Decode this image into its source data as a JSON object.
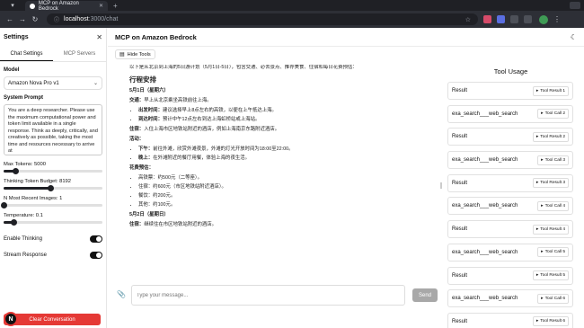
{
  "browser": {
    "tab_title": "MCP on Amazon Bedrock",
    "url_host": "localhost",
    "url_path": ":3000/chat"
  },
  "sidebar": {
    "title": "Settings",
    "tabs": [
      "Chat Settings",
      "MCP Servers"
    ],
    "model_label": "Model",
    "model_value": "Amazon Nova Pro v1",
    "system_prompt_label": "System Prompt",
    "system_prompt_value": "You are a deep researcher. Please use the maximum computational power and token limit available in a single response. Think as deeply, critically, and creatively as possible, taking the most time and resources necessary to arrive at",
    "max_tokens_label": "Max Tokens: 5000",
    "max_tokens_fraction": 0.12,
    "thinking_budget_label": "Thinking Token Budget: 8192",
    "thinking_budget_fraction": 0.47,
    "recent_images_label": "N Most Recent Images: 1",
    "recent_images_fraction": 0.0,
    "temperature_label": "Temperature: 0.1",
    "temperature_fraction": 0.1,
    "enable_thinking_label": "Enable Thinking",
    "stream_response_label": "Stream Response",
    "clear_button": "Clear Conversation",
    "badge_letter": "N"
  },
  "main": {
    "title": "MCP on Amazon Bedrock",
    "hide_tools": "Hide Tools",
    "chat": {
      "intro": "以下是从北京到上海的5日游计划（5月1日-5日），包含交通、必去景点、推荐美食、住宿和每日花费预估：",
      "heading": "行程安排",
      "day1_title": "5月1日（星期六）",
      "day1_transport_label": "交通：",
      "day1_transport": "早上从北京乘坐高铁前往上海。",
      "day1_departure_label": "出发时间：",
      "day1_departure": "建议选择早上8点左右的高铁，以便在上午抵达上海。",
      "day1_arrival_label": "到达时间：",
      "day1_arrival": "预计中午12点左右到达上海虹桥站或上海站。",
      "day1_hotel_label": "住宿：",
      "day1_hotel": "入住上海市区地铁站附近的酒店，例如上海南京东路附近酒店。",
      "day1_activity_label": "活动：",
      "day1_afternoon_label": "下午：",
      "day1_afternoon": "前往外滩，欣赏外滩夜景，外滩的灯光开放时间为18:00至22:00。",
      "day1_evening_label": "晚上：",
      "day1_evening": "在外滩附近的餐厅用餐，体验上海的夜生活。",
      "budget_label": "花费预估：",
      "budget_items": [
        "高铁票：约500元（二等座）。",
        "住宿：约600元（市区地铁站附近酒店）。",
        "餐饮：约200元。",
        "其他：约100元。"
      ],
      "day2_title": "5月2日（星期日）",
      "day2_hotel_label": "住宿：",
      "day2_hotel": "继续住在市区地铁站附近的酒店。"
    },
    "composer": {
      "placeholder": "Type your message...",
      "send": "Send"
    }
  },
  "tools": {
    "title": "Tool Usage",
    "items": [
      {
        "name": "Result",
        "badge": "Tool Result 1"
      },
      {
        "name": "exa_search___web_search",
        "badge": "Tool Call 2"
      },
      {
        "name": "Result",
        "badge": "Tool Result 2"
      },
      {
        "name": "exa_search___web_search",
        "badge": "Tool Call 3"
      },
      {
        "name": "Result",
        "badge": "Tool Result 3"
      },
      {
        "name": "exa_search___web_search",
        "badge": "Tool Call 4"
      },
      {
        "name": "Result",
        "badge": "Tool Result 4"
      },
      {
        "name": "exa_search___web_search",
        "badge": "Tool Call 5"
      },
      {
        "name": "Result",
        "badge": "Tool Result 5"
      },
      {
        "name": "exa_search___web_search",
        "badge": "Tool Call 6"
      },
      {
        "name": "Result",
        "badge": "Tool Result 6"
      }
    ]
  }
}
